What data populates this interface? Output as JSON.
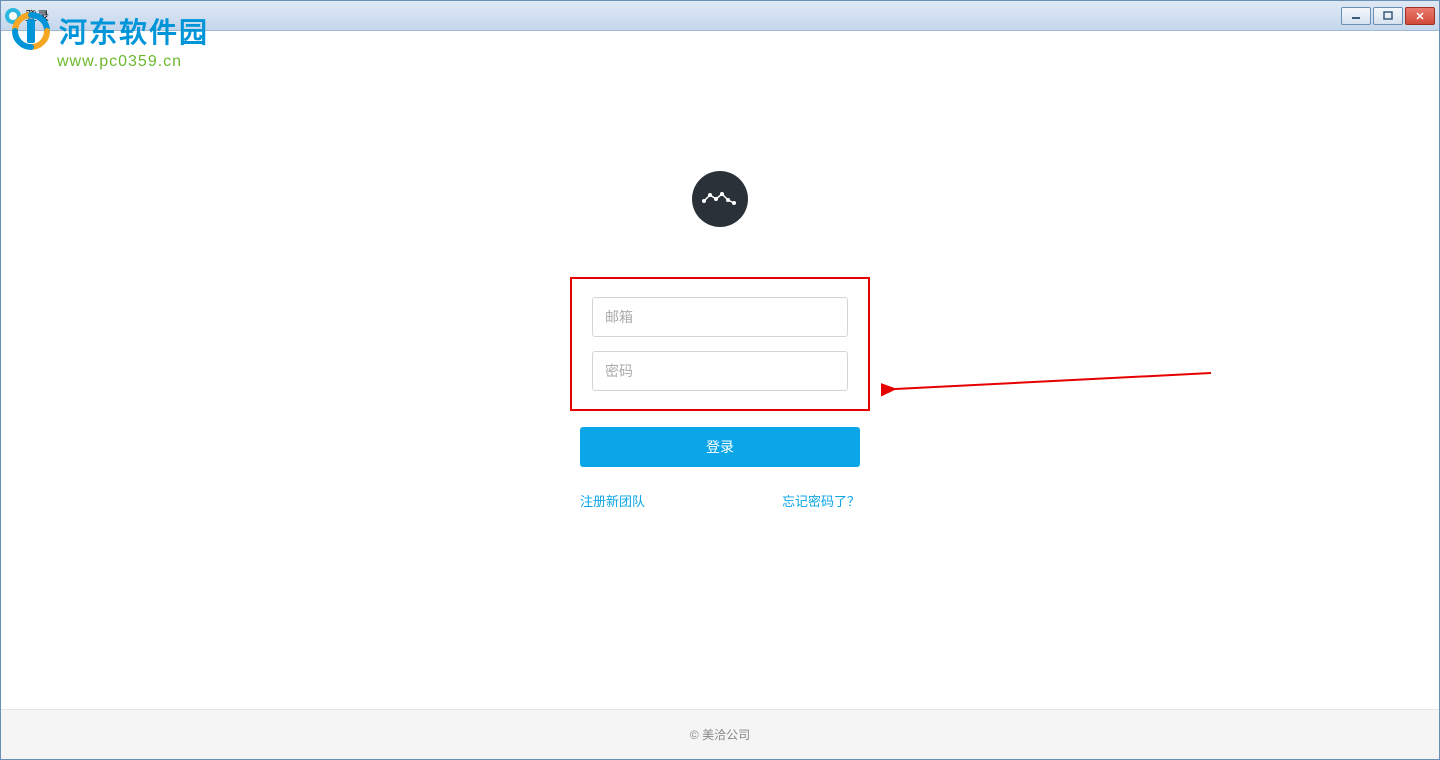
{
  "window": {
    "title": "登录"
  },
  "watermark": {
    "name": "河东软件园",
    "url": "www.pc0359.cn"
  },
  "form": {
    "email_placeholder": "邮箱",
    "password_placeholder": "密码",
    "login_button": "登录"
  },
  "links": {
    "register": "注册新团队",
    "forgot": "忘记密码了？"
  },
  "footer": {
    "copyright": "© 美洽公司"
  }
}
